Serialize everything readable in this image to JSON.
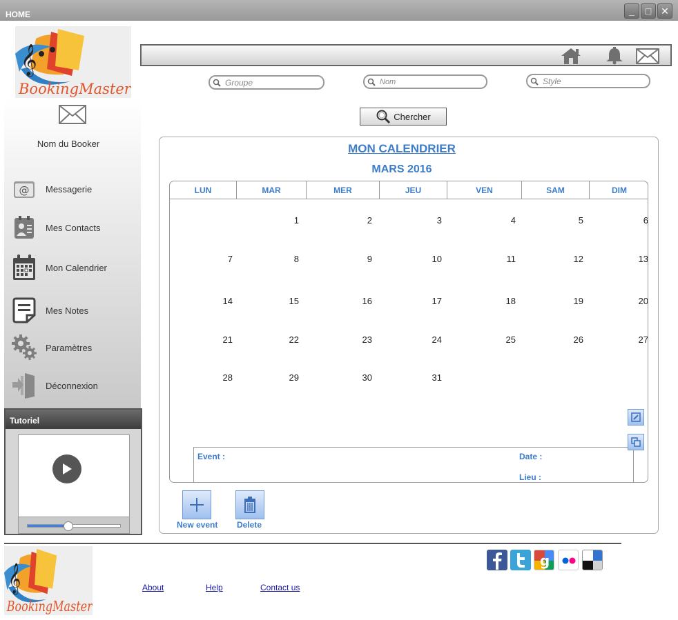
{
  "window": {
    "title": "HOME",
    "buttons": {
      "minimize": "_",
      "maximize": "□",
      "close": "✕"
    }
  },
  "brand": {
    "name": "BookingMaster"
  },
  "sidebar": {
    "booker_name": "Nom du Booker",
    "items": [
      {
        "label": "Messagerie",
        "icon": "mail-icon"
      },
      {
        "label": "Mes Contacts",
        "icon": "contacts-icon"
      },
      {
        "label": "Mon Calendrier",
        "icon": "calendar-icon"
      },
      {
        "label": "Mes Notes",
        "icon": "notes-icon"
      },
      {
        "label": "Paramètres",
        "icon": "gear-icon"
      },
      {
        "label": "Déconnexion",
        "icon": "logout-icon"
      }
    ]
  },
  "tutorial": {
    "title": "Tutoriel",
    "progress": 0.44
  },
  "search": {
    "group_placeholder": "Groupe",
    "name_placeholder": "Nom",
    "style_placeholder": "Style",
    "button_label": "Chercher"
  },
  "calendar": {
    "title": "MON CALENDRIER",
    "month": "MARS 2016",
    "day_names": [
      "LUN",
      "MAR",
      "MER",
      "JEU",
      "VEN",
      "SAM",
      "DIM"
    ],
    "first_weekday_index": 1,
    "days_in_month": 31
  },
  "event": {
    "event_label": "Event :",
    "date_label": "Date :",
    "place_label": "Lieu :"
  },
  "actions": {
    "new_event": "New event",
    "delete": "Delete"
  },
  "footer": {
    "links": [
      "About",
      "Help",
      "Contact us"
    ],
    "social": [
      "facebook-icon",
      "twitter-icon",
      "google-icon",
      "flickr-icon",
      "delicious-icon"
    ]
  },
  "colors": {
    "accent": "#3d7cc9",
    "link": "#1a1aa6"
  }
}
